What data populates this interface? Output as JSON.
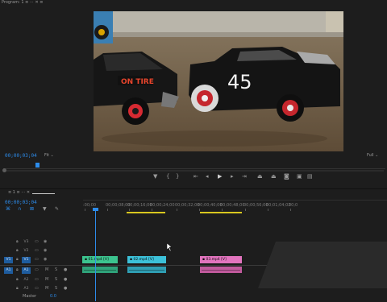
{
  "monitor": {
    "title": "Program: 1 ≡ ⋯ ✕ ≡",
    "timecode": "00;00;03;04",
    "fit_label": "Fit",
    "full_label": "Full",
    "transport": [
      {
        "name": "add-marker",
        "glyph": "▼"
      },
      {
        "name": "mark-in",
        "glyph": "{"
      },
      {
        "name": "mark-out",
        "glyph": "}"
      },
      {
        "name": "go-to-in",
        "glyph": "⇤"
      },
      {
        "name": "step-back",
        "glyph": "◂"
      },
      {
        "name": "play",
        "glyph": "▶"
      },
      {
        "name": "step-forward",
        "glyph": "▸"
      },
      {
        "name": "go-to-out",
        "glyph": "⇥"
      },
      {
        "name": "lift",
        "glyph": "⏏"
      },
      {
        "name": "extract",
        "glyph": "⏏"
      },
      {
        "name": "export-frame",
        "glyph": "◙"
      },
      {
        "name": "comparison-view",
        "glyph": "▣"
      },
      {
        "name": "settings",
        "glyph": "▤"
      }
    ]
  },
  "timeline": {
    "sequence_tab": "1 ≡ ⋯ ✕",
    "timecode": "00;00;03;04",
    "ruler_labels": [
      ":00;00",
      "00;00;08;00",
      "00;00;16;00",
      "00;00;24;00",
      "00;00;32;00",
      "00;00;40;00",
      "00;00;48;00",
      "00;00;56;00",
      "00;01;04;02",
      "00;0"
    ],
    "tracks": [
      {
        "id": "V3",
        "kind": "video",
        "targeted": false
      },
      {
        "id": "V2",
        "kind": "video",
        "targeted": false
      },
      {
        "id": "V1",
        "kind": "video",
        "targeted": true,
        "source": "V1"
      },
      {
        "id": "A1",
        "kind": "audio",
        "targeted": true,
        "source": "A1"
      },
      {
        "id": "A2",
        "kind": "audio",
        "targeted": false
      },
      {
        "id": "A3",
        "kind": "audio",
        "targeted": false
      }
    ],
    "master_label": "Master",
    "master_value": "0.0",
    "clips": [
      {
        "name": "01.mp4 [V]",
        "color": "#3cc48f"
      },
      {
        "name": "02.mp4 [V]",
        "color": "#3cc1d9"
      },
      {
        "name": "03.mp4 [V]",
        "color": "#e274be"
      }
    ],
    "audio_colors": [
      "#2fa37a",
      "#2f9fb4",
      "#c15a9d"
    ]
  },
  "video_frame": {
    "car_number": "45",
    "car_text": "ON TIRE"
  }
}
